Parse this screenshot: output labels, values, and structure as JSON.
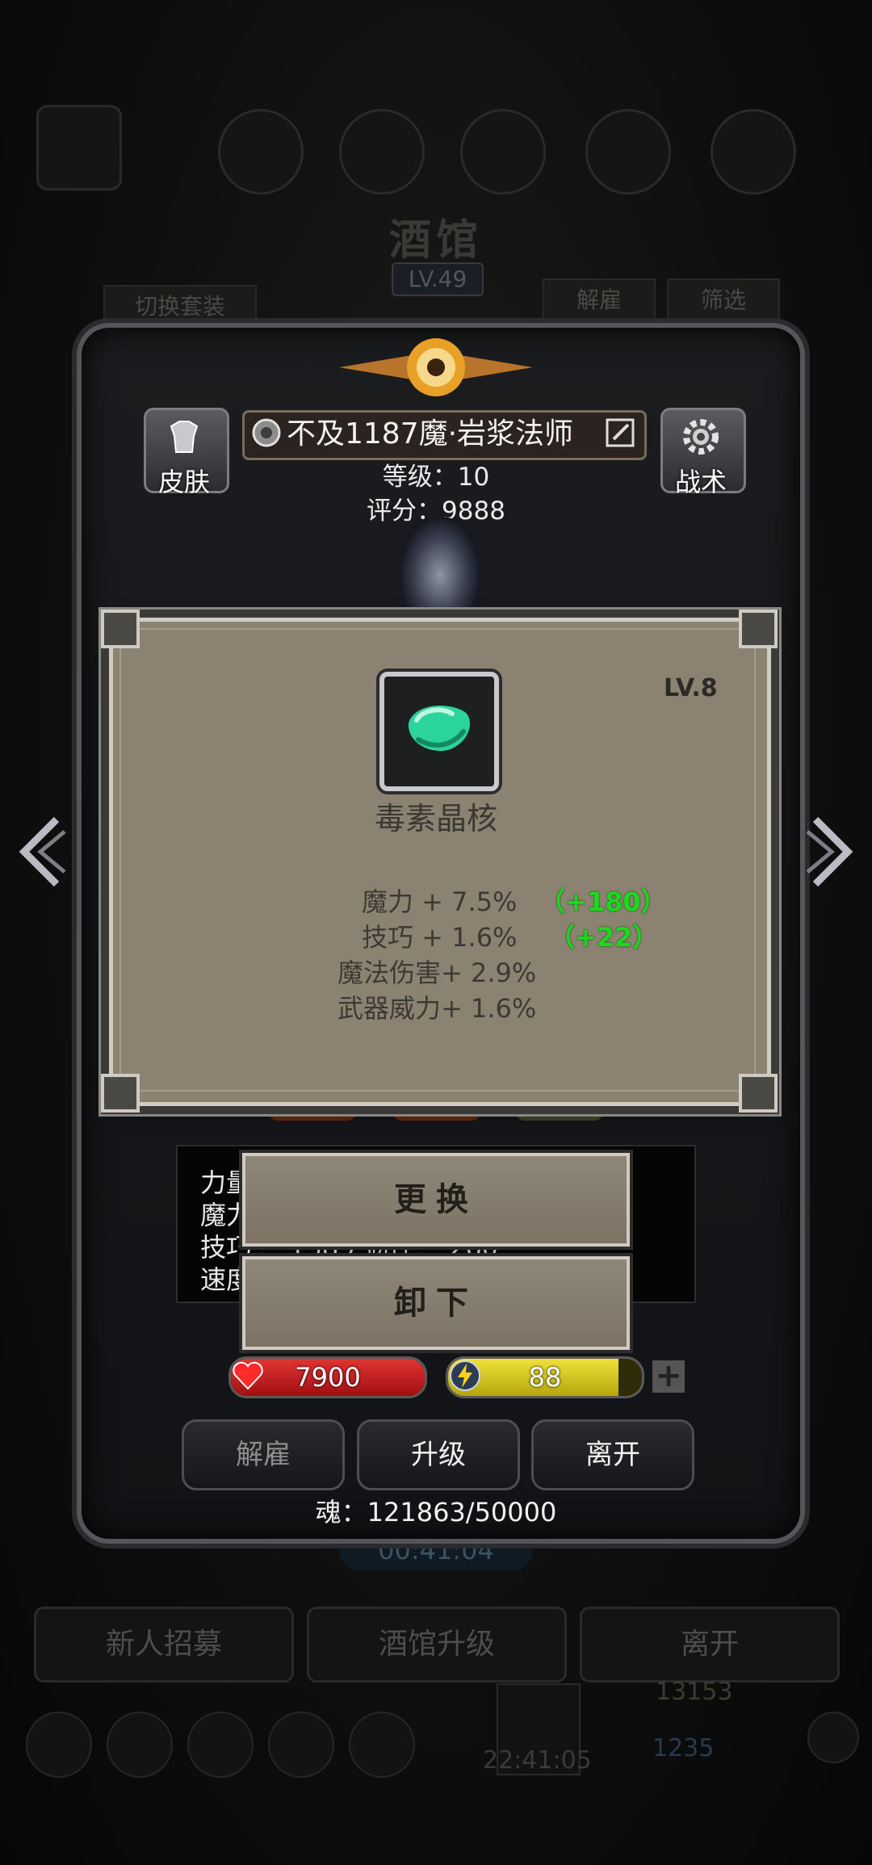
{
  "background": {
    "title": "酒馆",
    "level": "LV.49",
    "switch_outfit": "切换套装",
    "dismiss": "解雇",
    "filter": "筛选",
    "timer": "00:41:04",
    "recruit": "新人招募",
    "tavern_upgrade": "酒馆升级",
    "leave": "离开",
    "currency_a": "13153",
    "clock": "22:41:05",
    "currency_b": "1235"
  },
  "hero": {
    "name": "不及1187魔·岩浆法师",
    "level_text": "等级：10",
    "score_text": "评分：9888",
    "skin_label": "皮肤",
    "tactics_label": "战术",
    "hp": "7900",
    "energy": "88",
    "soul_text": "魂：121863/50000",
    "stats": [
      {
        "label": "力量"
      },
      {
        "label": "魔力"
      },
      {
        "label": "技巧",
        "extra": "： 1389   韧性： 260"
      },
      {
        "label": "速度"
      }
    ],
    "buttons": {
      "dismiss": "解雇",
      "upgrade": "升级",
      "leave": "离开"
    }
  },
  "item": {
    "name": "毒素晶核",
    "level": "LV.8",
    "attributes": [
      {
        "text": "魔力 + 7.5%",
        "bonus": "（+180）"
      },
      {
        "text": "技巧 + 1.6%",
        "bonus": "（+22）"
      },
      {
        "text": "魔法伤害+ 2.9%",
        "bonus": ""
      },
      {
        "text": "武器威力+ 1.6%",
        "bonus": ""
      }
    ],
    "replace": "更换",
    "unequip": "卸下"
  },
  "colors": {
    "hp": "#c2171a",
    "energy": "#cdbf12",
    "bonus": "#1bd91b",
    "popup": "#8c8272"
  }
}
